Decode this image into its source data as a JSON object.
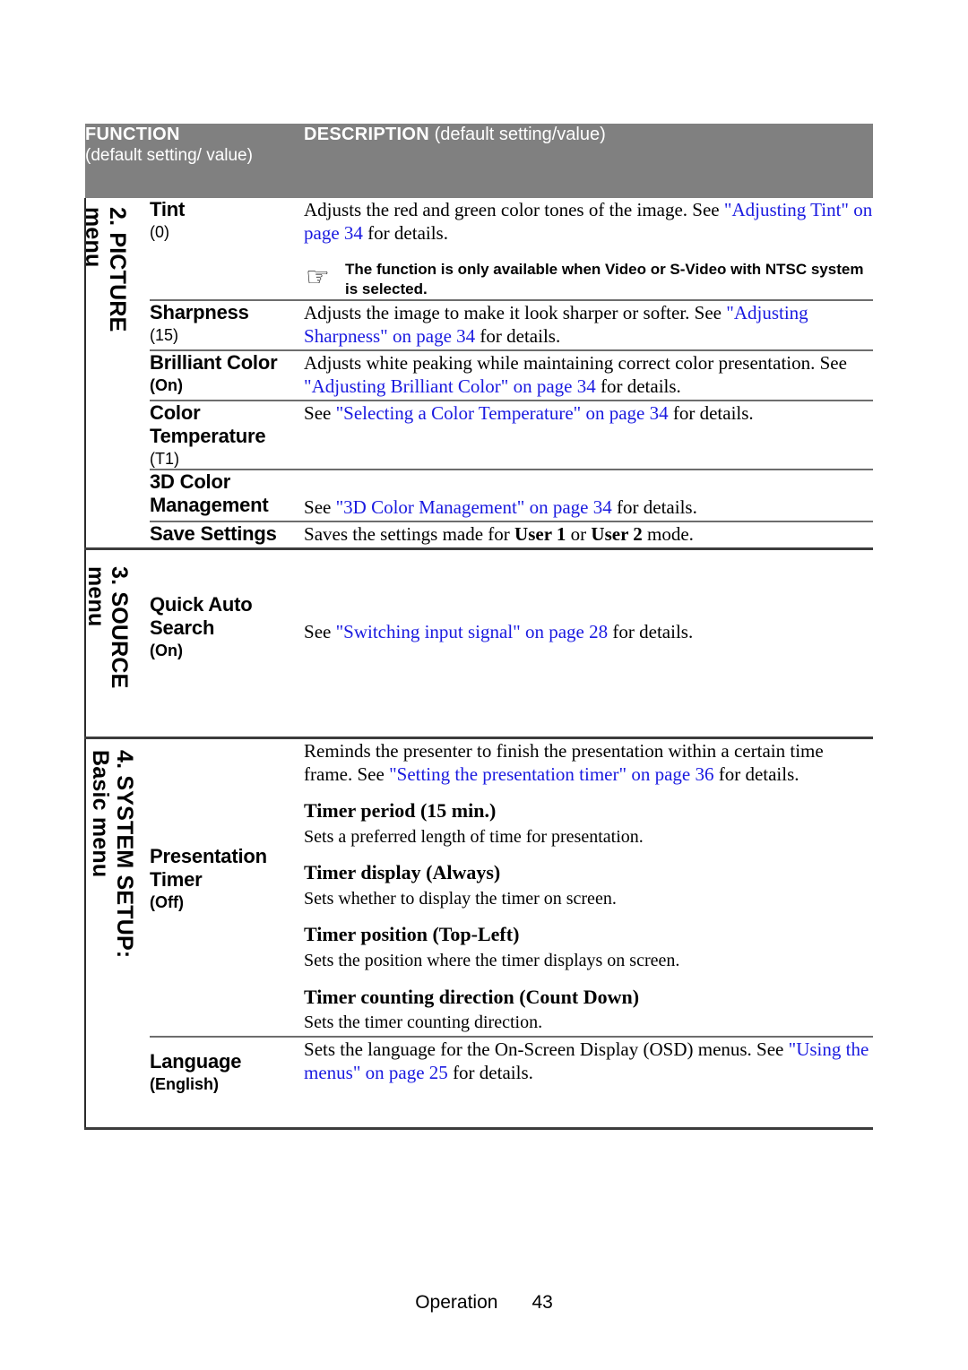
{
  "document": {
    "footer": {
      "section_label": "Operation",
      "page_number": "43"
    }
  },
  "table": {
    "header": {
      "function_title": "FUNCTION",
      "function_subtitle": "(default setting/ value)",
      "description_title": "DESCRIPTION",
      "description_subtitle": "(default setting/value)"
    },
    "groups": [
      {
        "menu_label_line1": "2. PICTURE",
        "menu_label_line2": "menu",
        "rows": [
          {
            "name": "Tint",
            "default": "(0)",
            "desc_lead": "Adjusts the red and green color tones of the image. See ",
            "desc_link": "\"Adjusting Tint\" on page 34",
            "desc_tail": " for details.",
            "note_icon": "pointing-hand-icon",
            "note_text": "The function is only available when Video or S-Video with NTSC system is selected."
          },
          {
            "name": "Sharpness",
            "default": "(15)",
            "desc_lead": "Adjusts the image to make it look sharper or softer. See ",
            "desc_link": "\"Adjusting Sharpness\" on page 34",
            "desc_tail": " for details."
          },
          {
            "name": "Brilliant Color",
            "default": "(On)",
            "desc_lead": "Adjusts white peaking while maintaining correct color presentation. See ",
            "desc_link": "\"Adjusting Brilliant Color\" on page 34",
            "desc_tail": " for details."
          },
          {
            "name": "Color Temperature",
            "default": "(T1)",
            "desc_lead": "See ",
            "desc_link": "\"Selecting a Color Temperature\" on page 34",
            "desc_tail": " for details."
          },
          {
            "name": "3D Color Management",
            "default": "",
            "desc_lead": "See ",
            "desc_link": "\"3D Color Management\" on page 34",
            "desc_tail": " for details."
          },
          {
            "name": "Save Settings",
            "default": "",
            "desc_lead": "Saves the settings made for ",
            "desc_bold1": "User 1",
            "desc_mid": " or ",
            "desc_bold2": "User 2",
            "desc_tail": " mode."
          }
        ]
      },
      {
        "menu_label_line1": "3. SOURCE",
        "menu_label_line2": "menu",
        "rows": [
          {
            "name": "Quick Auto Search",
            "default": "(On)",
            "desc_lead": "See ",
            "desc_link": "\"Switching input signal\" on page 28",
            "desc_tail": " for details."
          }
        ]
      },
      {
        "menu_label_line1": "4. SYSTEM SETUP:",
        "menu_label_line2": "Basic menu",
        "rows": [
          {
            "name": "Presentation Timer",
            "default": "(Off)",
            "desc_lead": "Reminds the presenter to finish the presentation within a certain time frame. See ",
            "desc_link": "\"Setting the presentation timer\" on page 36",
            "desc_tail": " for details.",
            "subitems": [
              {
                "heading": "Timer period (15 min.)",
                "body": "Sets a preferred length of time for presentation."
              },
              {
                "heading": "Timer display (Always)",
                "body": "Sets whether to display the timer on screen."
              },
              {
                "heading": "Timer position (Top-Left)",
                "body": "Sets the position where the timer displays on screen."
              },
              {
                "heading": "Timer counting direction (Count Down)",
                "body": "Sets the timer counting direction."
              }
            ]
          },
          {
            "name": "Language",
            "default": "(English)",
            "default_bold": true,
            "desc_lead": "Sets the language for the On-Screen Display (OSD) menus. See ",
            "desc_link": "\"Using the menus\" on page 25",
            "desc_tail": " for details."
          }
        ]
      }
    ]
  },
  "colors": {
    "header_background": "#808080",
    "header_text": "#ffffff",
    "link": "#1a1ae0",
    "rule": "#3c3c3c",
    "body_text": "#000000"
  }
}
